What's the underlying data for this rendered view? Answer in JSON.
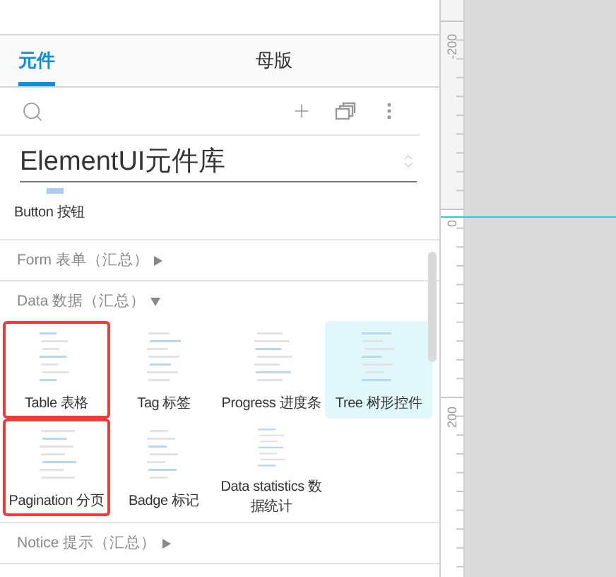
{
  "tabs": [
    {
      "label": "元件",
      "selected": true
    },
    {
      "label": "母版",
      "selected": false
    }
  ],
  "library": {
    "title": "ElementUI元件库"
  },
  "loose_items": [
    {
      "label": "Button 按钮"
    }
  ],
  "sections": [
    {
      "title": "Form 表单（汇总）",
      "expanded": false
    },
    {
      "title": "Data 数据（汇总）",
      "expanded": true,
      "items": [
        {
          "label": "Table 表格",
          "selected": false,
          "outlined": true
        },
        {
          "label": "Tag 标签",
          "selected": false,
          "outlined": false
        },
        {
          "label": "Progress 进度条",
          "selected": false,
          "outlined": false
        },
        {
          "label": "Tree 树形控件",
          "selected": true,
          "outlined": false
        },
        {
          "label": "Pagination 分页",
          "selected": false,
          "outlined": true
        },
        {
          "label": "Badge 标记",
          "selected": false,
          "outlined": false
        },
        {
          "label": "Data statistics 数据统计",
          "selected": false,
          "outlined": false
        }
      ]
    },
    {
      "title": "Notice 提示（汇总）",
      "expanded": false
    }
  ],
  "ruler": {
    "labels": [
      "-200",
      "0",
      "200"
    ]
  }
}
